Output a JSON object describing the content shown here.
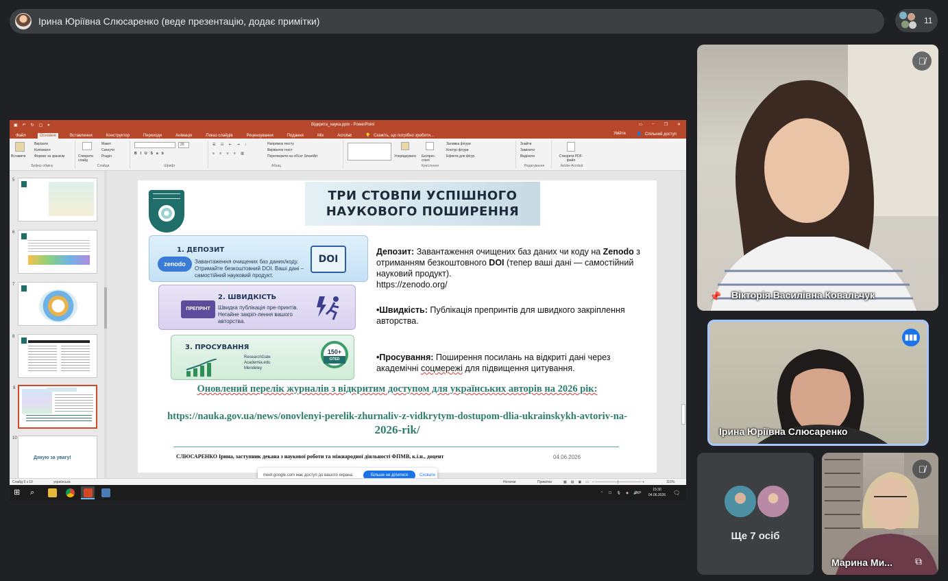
{
  "presenter_bar": {
    "title": "Ірина Юріївна Слюсаренко (веде презентацію, додає примітки)"
  },
  "participants_count": "11",
  "powerpoint": {
    "doc_title": "Відкрита_наука.pptx - PowerPoint",
    "tabs": [
      "Файл",
      "Основне",
      "Вставлення",
      "Конструктор",
      "Переходи",
      "Анімація",
      "Показ слайдів",
      "Рецензування",
      "Подання",
      "Mix",
      "Acrobat"
    ],
    "tell_me": "Скажіть, що потрібно зробити...",
    "sign_in": "Увійти",
    "share": "Спільний доступ",
    "ribbon": {
      "paste": "Вставити",
      "cut": "Вирізати",
      "copy": "Копіювати",
      "format_painter": "Формат за зразком",
      "clipboard": "Буфер обміну",
      "new_slide": "Створити слайд",
      "layout": "Макет",
      "reset": "Скинути",
      "section": "Розділ",
      "slides": "Слайди",
      "font": "Шрифт",
      "paragraph": "Абзац",
      "text_dir": "Напрямок тексту",
      "align_text": "Вирівняти текст",
      "smartart": "Перетворити на об'єкт SmartArt",
      "arrange": "Упорядкувати",
      "quick_styles": "Експрес-стилі",
      "shape_fill": "Заливка фігури",
      "shape_outline": "Контур фігури",
      "shape_effects": "Ефекти для фігур",
      "drawing": "Креслення",
      "find": "Знайти",
      "replace": "Замінити",
      "select": "Виділити",
      "editing": "Редагування",
      "create_pdf": "Створити PDF-файл",
      "adobe_acrobat": "Adobe Acrobat",
      "font_size": "20"
    },
    "thumbnails": [
      {
        "num": "5"
      },
      {
        "num": "6"
      },
      {
        "num": "7"
      },
      {
        "num": "8"
      },
      {
        "num": "9"
      },
      {
        "num": "10",
        "text": "Дякую за увагу!"
      }
    ],
    "statusbar": {
      "slide": "Слайд 9 з 10",
      "lang": "українська",
      "notes": "Нотатки",
      "comments": "Примітки",
      "zoom": "115%"
    },
    "taskbar": {
      "lang": "УКР",
      "time": "15:30",
      "date": "04.06.2026"
    }
  },
  "slide": {
    "title_line1": "ТРИ СТОВПИ УСПІШНОГО",
    "title_line2": "НАУКОВОГО ПОШИРЕННЯ",
    "card1": {
      "title": "1. ДЕПОЗИТ",
      "brand": "zenodo",
      "text": "Завантаження очищених баз даних/коду. Отримайте безкоштовний DOI. Ваші дані – самостійний науковий продукт.",
      "badge": "DOI"
    },
    "card2": {
      "title": "2. ШВИДКІСТЬ",
      "badge": "ПРЕПРІНТ",
      "text": "Швидка публікація пре-принтів. Негайне закріп-лення вашого авторства."
    },
    "card3": {
      "title": "3. ПРОСУВАННЯ",
      "net1": "ResearchGate",
      "net2": "Academia.edu",
      "net3": "Mendeley",
      "cited_num": "150+",
      "cited_label": "CITED"
    },
    "p1_bold": "Депозит:",
    "p1_text": " Завантаження очищених баз даних чи коду на ",
    "p1_zenodo": "Zenodo",
    "p1_text2": " з отриманням безкоштовного ",
    "p1_doi": "DOI",
    "p1_text3": " (тепер ваші дані — самостійний науковий продукт).",
    "p1_url": "https://zenodo.org/",
    "p2_bold": "•Швидкість:",
    "p2_text": " Публікація препринтів для швидкого закріплення авторства.",
    "p3_bold": "•Просування:",
    "p3_text1": " Поширення посилань на відкриті дані через академічні ",
    "p3_underline": "соцмережі",
    "p3_text2": " для підвищення цитування.",
    "journal_heading": "Оновлений перелік журналів з відкритим доступом для українських авторів на 2026 рік:",
    "journal_url_a": "https://nauka.gov.ua/news/onovlenyi-perelik-zhurnaliv-z-vidkrytym-dostupom-dlia-ukrainskykh-avtoriv-na-",
    "journal_url_b": "2026-rik/",
    "footer": "СЛЮСАРЕНКО Ірина, заступник декана з наукової роботи та міжнародної діяльності ФПМВ, к.і.н., доцент",
    "date": "04.06.2026"
  },
  "share_popup": {
    "text": "meet.google.com має доступ до вашого екрана.",
    "stop": "Більше не ділитися",
    "hide": "Сховати"
  },
  "tiles": {
    "t1_name": "Вікторія Василівна Ковальчук",
    "t2_name": "Ірина Юріївна Слюсаренко",
    "t3_more": "Ще 7 осіб",
    "t4_name": "Марина Ми..."
  },
  "colors": {
    "meet_bg": "#202124",
    "pp_accent": "#b7472a",
    "slide_teal": "#2e7d6b",
    "active_speaker": "#a8c7fa"
  }
}
